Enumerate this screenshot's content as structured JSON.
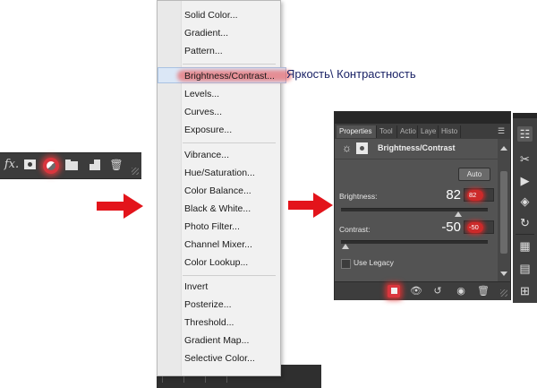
{
  "mini_toolbar": {
    "fx_label": "fx.",
    "icons": [
      "fx-icon",
      "add-mask-icon",
      "adjustment-layer-icon",
      "group-folder-icon",
      "new-layer-icon",
      "trash-icon"
    ]
  },
  "menu": {
    "highlight_color": "#dbe7f6",
    "glow_color": "#ec4646",
    "groups": [
      [
        "Solid Color...",
        "Gradient...",
        "Pattern..."
      ],
      [
        "Brightness/Contrast...",
        "Levels...",
        "Curves...",
        "Exposure..."
      ],
      [
        "Vibrance...",
        "Hue/Saturation...",
        "Color Balance...",
        "Black & White...",
        "Photo Filter...",
        "Channel Mixer...",
        "Color Lookup..."
      ],
      [
        "Invert",
        "Posterize...",
        "Threshold...",
        "Gradient Map...",
        "Selective Color..."
      ]
    ]
  },
  "annotation": {
    "russian_label": "Яркость\\ Контрастность"
  },
  "properties_panel": {
    "tabs": [
      "Properties",
      "Tool",
      "Actio",
      "Laye",
      "Histo"
    ],
    "title": "Brightness/Contrast",
    "auto_label": "Auto",
    "brightness": {
      "label": "Brightness:",
      "value": "82",
      "field_value": "82"
    },
    "contrast": {
      "label": "Contrast:",
      "value": "-50",
      "field_value": "-50"
    },
    "use_legacy_label": "Use Legacy",
    "use_legacy_checked": false,
    "footer_icons": [
      "clip-to-layer-icon",
      "view-previous-state-icon",
      "reset-icon",
      "visibility-icon",
      "delete-icon"
    ]
  },
  "right_strip": {
    "icons": [
      "properties-icon",
      "tools-icon",
      "play-icon",
      "layers-icon",
      "history-icon",
      "swatches-icon",
      "gradients-icon",
      "grid-icon"
    ]
  },
  "colors": {
    "accent_red": "#e3141b",
    "panel_bg": "#535353",
    "dark_bg": "#3c3c3c",
    "ru_text": "#1b2366"
  }
}
